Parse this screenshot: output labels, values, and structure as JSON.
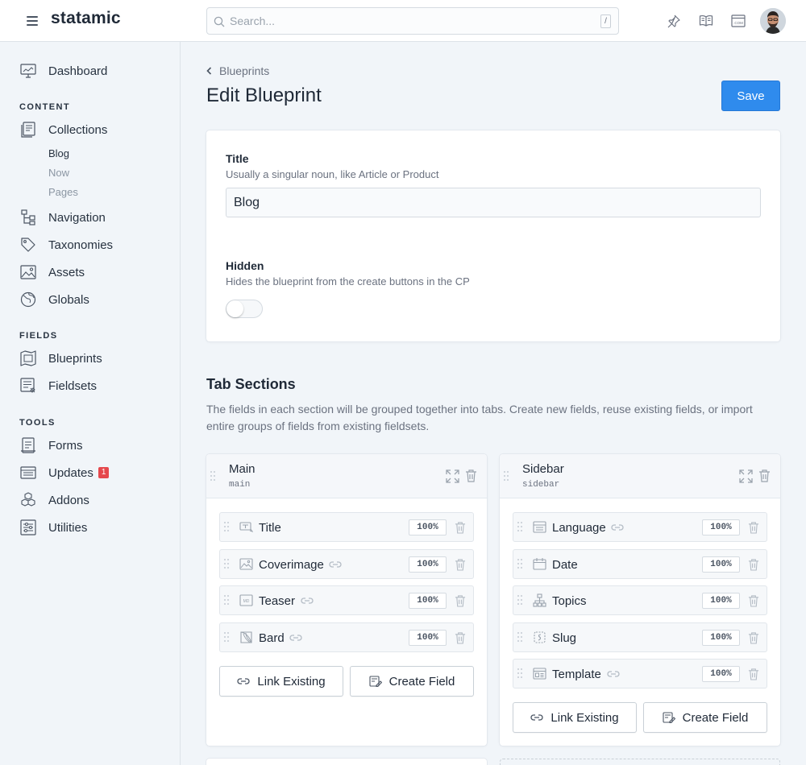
{
  "app": {
    "logo": "statamic"
  },
  "search": {
    "placeholder": "Search...",
    "shortcut": "/"
  },
  "header_icons": [
    "pin-icon",
    "book-icon",
    "site-icon"
  ],
  "sidebar": {
    "dashboard": "Dashboard",
    "sections": {
      "content": "CONTENT",
      "fields": "FIELDS",
      "tools": "TOOLS"
    },
    "content_items": {
      "collections": "Collections",
      "navigation": "Navigation",
      "taxonomies": "Taxonomies",
      "assets": "Assets",
      "globals": "Globals"
    },
    "collection_children": [
      "Blog",
      "Now",
      "Pages"
    ],
    "fields_items": {
      "blueprints": "Blueprints",
      "fieldsets": "Fieldsets"
    },
    "tools_items": {
      "forms": "Forms",
      "updates": "Updates",
      "updates_badge": "1",
      "addons": "Addons",
      "utilities": "Utilities"
    }
  },
  "breadcrumb": "Blueprints",
  "page_title": "Edit Blueprint",
  "save_label": "Save",
  "settings": {
    "title_label": "Title",
    "title_help": "Usually a singular noun, like Article or Product",
    "title_value": "Blog",
    "hidden_label": "Hidden",
    "hidden_help": "Hides the blueprint from the create buttons in the CP",
    "hidden_value": false
  },
  "tab_sections": {
    "title": "Tab Sections",
    "description": "The fields in each section will be grouped together into tabs. Create new fields, reuse existing fields, or import entire groups of fields from existing fieldsets."
  },
  "tabs": [
    {
      "name": "Main",
      "handle": "main",
      "fields": [
        {
          "name": "Title",
          "width": "100%",
          "icon": "text-icon",
          "linked": false
        },
        {
          "name": "Coverimage",
          "width": "100%",
          "icon": "image-icon",
          "linked": true
        },
        {
          "name": "Teaser",
          "width": "100%",
          "icon": "markdown-icon",
          "linked": true
        },
        {
          "name": "Bard",
          "width": "100%",
          "icon": "bard-icon",
          "linked": true
        }
      ]
    },
    {
      "name": "Sidebar",
      "handle": "sidebar",
      "fields": [
        {
          "name": "Language",
          "width": "100%",
          "icon": "select-icon",
          "linked": true
        },
        {
          "name": "Date",
          "width": "100%",
          "icon": "calendar-icon",
          "linked": false
        },
        {
          "name": "Topics",
          "width": "100%",
          "icon": "taxonomy-icon",
          "linked": false
        },
        {
          "name": "Slug",
          "width": "100%",
          "icon": "slug-icon",
          "linked": false
        },
        {
          "name": "Template",
          "width": "100%",
          "icon": "template-icon",
          "linked": true
        }
      ]
    }
  ],
  "buttons": {
    "link_existing": "Link Existing",
    "create_field": "Create Field"
  },
  "colors": {
    "primary": "#2f8bed",
    "badge": "#e5484d",
    "background": "#f1f5f9"
  }
}
